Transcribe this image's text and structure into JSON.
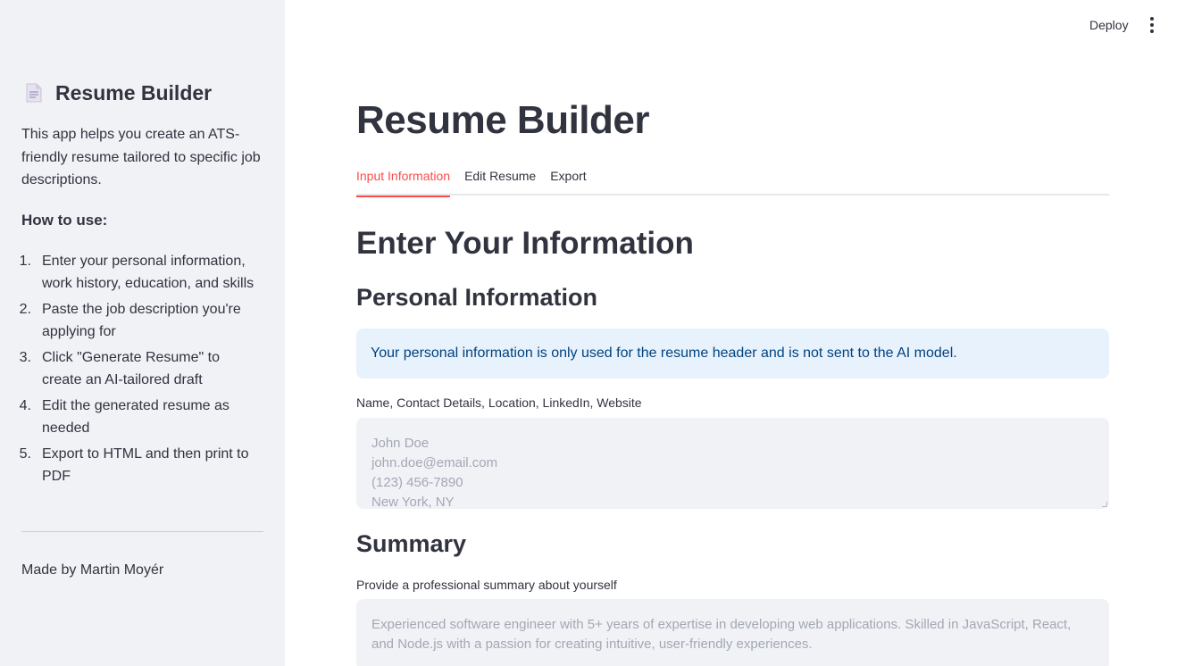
{
  "sidebar": {
    "title": "Resume Builder",
    "description": "This app helps you create an ATS-friendly resume tailored to specific job descriptions.",
    "howto_heading": "How to use:",
    "steps": [
      {
        "num": "1.",
        "text": "Enter your personal information, work history, education, and skills"
      },
      {
        "num": "2.",
        "text": "Paste the job description you're applying for"
      },
      {
        "num": "3.",
        "text": "Click \"Generate Resume\" to create an AI-tailored draft"
      },
      {
        "num": "4.",
        "text": "Edit the generated resume as needed"
      },
      {
        "num": "5.",
        "text": "Export to HTML and then print to PDF"
      }
    ],
    "footer": "Made by Martin Moyér"
  },
  "header": {
    "deploy_label": "Deploy"
  },
  "main": {
    "title": "Resume Builder",
    "tabs": [
      {
        "label": "Input Information",
        "active": true
      },
      {
        "label": "Edit Resume",
        "active": false
      },
      {
        "label": "Export",
        "active": false
      }
    ],
    "section_heading": "Enter Your Information",
    "personal": {
      "heading": "Personal Information",
      "info": "Your personal information is only used for the resume header and is not sent to the AI model.",
      "label": "Name, Contact Details, Location, LinkedIn, Website",
      "placeholder": "John Doe\njohn.doe@email.com\n(123) 456-7890\nNew York, NY"
    },
    "summary": {
      "heading": "Summary",
      "label": "Provide a professional summary about yourself",
      "placeholder": "Experienced software engineer with 5+ years of expertise in developing web applications. Skilled in JavaScript, React, and Node.js with a passion for creating intuitive, user-friendly experiences."
    }
  },
  "colors": {
    "accent": "#ff4b4b",
    "sidebar_bg": "#f0f2f6",
    "info_bg": "#e8f2fc",
    "info_text": "#004280"
  }
}
